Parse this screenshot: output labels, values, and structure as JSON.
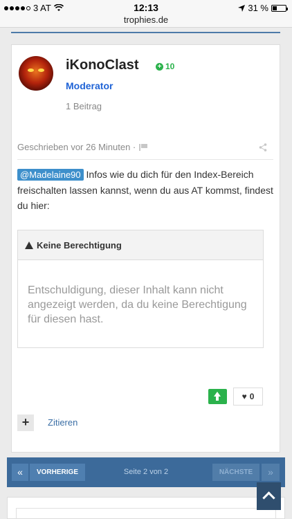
{
  "status_bar": {
    "carrier": "3 AT",
    "time": "12:13",
    "url": "trophies.de",
    "battery": "31 %"
  },
  "post": {
    "author": "iKonoClast",
    "reputation": "10",
    "role": "Moderator",
    "post_count": "1 Beitrag",
    "timestamp": "Geschrieben vor 26 Minuten ·",
    "mention": "@Madelaine90",
    "body": " Infos wie du dich für den Index-Bereich freischalten lassen kannst, wenn du aus AT kommst, findest du hier:",
    "no_permission_title": "Keine Berechtigung",
    "no_permission_text": "Entschuldigung, dieser Inhalt kann nicht angezeigt werden, da du keine Berechtigung für diesen hast.",
    "like_count": "0",
    "quote_label": "Zitieren"
  },
  "pagination": {
    "first": "«",
    "prev": "VORHERIGE",
    "info": "Seite 2 von 2",
    "next": "NÄCHSTE",
    "last": "»"
  },
  "colors": {
    "accent": "#3c6a9a",
    "moderator": "#1f63d6",
    "reputation": "#2bb24c",
    "mention": "#3d8fcb"
  }
}
